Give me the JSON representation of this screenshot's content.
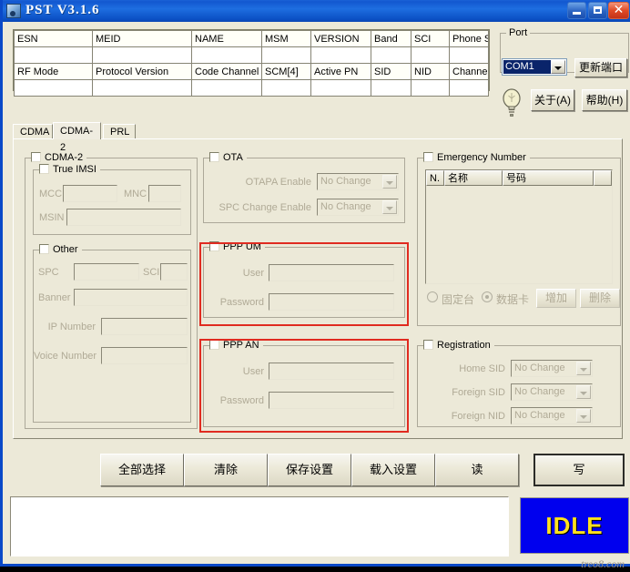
{
  "window": {
    "title": "PST V3.1.6",
    "icon": "app-icon",
    "buttons": {
      "minimize": "–",
      "maximize": "□",
      "close": "✕"
    }
  },
  "info_grid": {
    "row1_labels": [
      "ESN",
      "MEID",
      "NAME",
      "MSM",
      "VERSION",
      "Band",
      "SCI",
      "Phone State"
    ],
    "row1_values": [
      "",
      "",
      "",
      "",
      "",
      "",
      "",
      ""
    ],
    "row2_labels": [
      "RF Mode",
      "Protocol Version",
      "Code Channel",
      "SCM[4]",
      "Active PN",
      "SID",
      "NID",
      "Channel"
    ],
    "row2_values": [
      "",
      "",
      "",
      "",
      "",
      "",
      "",
      ""
    ]
  },
  "port": {
    "legend": "Port",
    "selected": "COM1",
    "update_label": "更新端口",
    "about_label": "关于(A)",
    "help_label": "帮助(H)"
  },
  "tabs": [
    {
      "label": "CDMA",
      "active": false
    },
    {
      "label": "CDMA-2",
      "active": true
    },
    {
      "label": "PRL",
      "active": false
    }
  ],
  "cdma2": {
    "group_label": "CDMA-2",
    "true_imsi": {
      "label": "True IMSI",
      "mcc_label": "MCC",
      "mcc_value": "",
      "mnc_label": "MNC",
      "mnc_value": "",
      "msin_label": "MSIN",
      "msin_value": ""
    },
    "other": {
      "label": "Other",
      "spc_label": "SPC",
      "spc_value": "",
      "sci_label": "SCI",
      "sci_value": "",
      "banner_label": "Banner",
      "banner_value": "",
      "ip_label": "IP Number",
      "ip_value": "",
      "voice_label": "Voice Number",
      "voice_value": ""
    },
    "ota": {
      "label": "OTA",
      "otapa_label": "OTAPA Enable",
      "otapa_value": "No Change",
      "spc_change_label": "SPC Change Enable",
      "spc_change_value": "No Change"
    },
    "ppp_um": {
      "label": "PPP UM",
      "user_label": "User",
      "user_value": "",
      "password_label": "Password",
      "password_value": "",
      "highlighted": true
    },
    "ppp_an": {
      "label": "PPP AN",
      "user_label": "User",
      "user_value": "",
      "password_label": "Password",
      "password_value": "",
      "highlighted": true
    },
    "emergency": {
      "label": "Emergency Number",
      "columns": [
        "N.",
        "名称",
        "号码",
        ""
      ],
      "rows": [],
      "radio_fixed": "固定台",
      "radio_datacard": "数据卡",
      "selected_radio": "数据卡",
      "add_label": "增加",
      "delete_label": "删除"
    },
    "registration": {
      "label": "Registration",
      "home_sid_label": "Home SID",
      "home_sid_value": "No Change",
      "foreign_sid_label": "Foreign SID",
      "foreign_sid_value": "No Change",
      "foreign_nid_label": "Foreign NID",
      "foreign_nid_value": "No Change"
    }
  },
  "commands": [
    {
      "label": "全部选择",
      "default": false
    },
    {
      "label": "清除",
      "default": false
    },
    {
      "label": "保存设置",
      "default": false
    },
    {
      "label": "载入设置",
      "default": false
    },
    {
      "label": "读",
      "default": false
    },
    {
      "label": "写",
      "default": true
    }
  ],
  "log": {
    "text": ""
  },
  "status": {
    "text": "IDLE",
    "bg": "#0000EE",
    "fg": "#FFE11C"
  },
  "watermark": {
    "text": "treo8.com"
  },
  "colors": {
    "titlebar": "#1257D0",
    "face": "#ECE9D8",
    "highlight_rect": "#E02B20",
    "combo_selected_bg": "#0A246A"
  }
}
